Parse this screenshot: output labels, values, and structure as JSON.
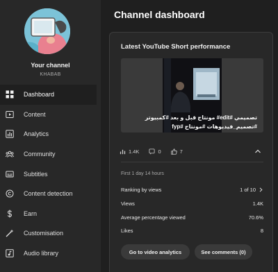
{
  "sidebar": {
    "channel_label": "Your channel",
    "channel_handle": "KHABAB",
    "items": [
      {
        "label": "Dashboard",
        "icon": "dashboard-icon",
        "active": true
      },
      {
        "label": "Content",
        "icon": "content-icon"
      },
      {
        "label": "Analytics",
        "icon": "analytics-icon"
      },
      {
        "label": "Community",
        "icon": "community-icon"
      },
      {
        "label": "Subtitles",
        "icon": "subtitles-icon"
      },
      {
        "label": "Content detection",
        "icon": "copyright-icon"
      },
      {
        "label": "Earn",
        "icon": "dollar-icon"
      },
      {
        "label": "Customisation",
        "icon": "wand-icon"
      },
      {
        "label": "Audio library",
        "icon": "audio-library-icon"
      }
    ]
  },
  "main": {
    "title": "Channel dashboard",
    "card": {
      "title": "Latest YouTube Short performance",
      "caption": "تصميمي #edit# مونتاج ﻗﺒﻞ و بعد #كمبيوتر #تصميم_فيديوهات #مونتاج #fyp",
      "views_count": "1.4K",
      "comments_count": "0",
      "likes_count": "7",
      "first_line": "First 1 day 14 hours",
      "metrics": {
        "ranking_label": "Ranking by views",
        "ranking_value": "1 of 10",
        "views_label": "Views",
        "views_value": "1.4K",
        "avg_label": "Average percentage viewed",
        "avg_value": "70.6%",
        "likes_label": "Likes",
        "likes_value": "8"
      },
      "buttons": {
        "analytics": "Go to video analytics",
        "comments": "See comments (0)"
      }
    }
  },
  "colors": {
    "background": "#1f1f1f",
    "sidebar": "#282828",
    "card": "#282828",
    "button": "#3a3a3a"
  }
}
